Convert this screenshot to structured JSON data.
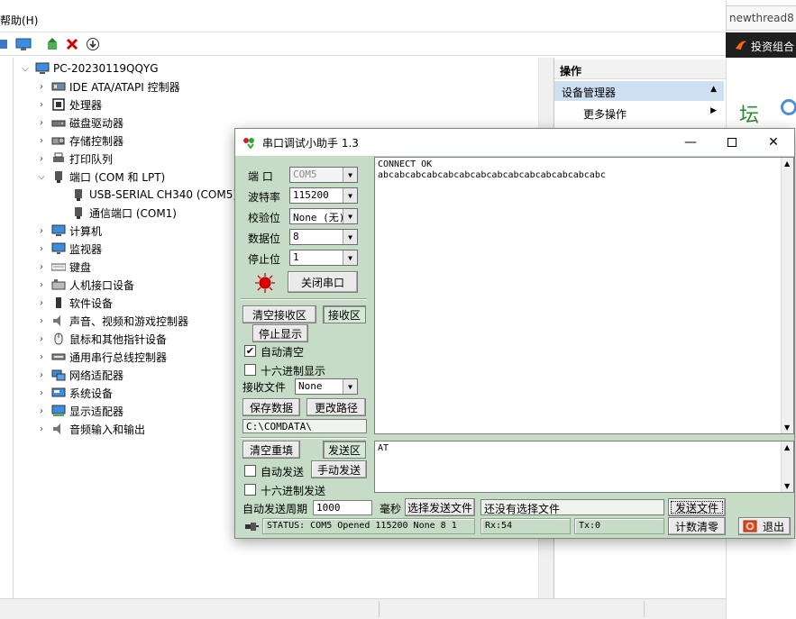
{
  "device_manager": {
    "menu_help": "帮助(H)",
    "tree": {
      "root": "PC-20230119QQYG",
      "items": [
        {
          "label": "IDE ATA/ATAPI 控制器",
          "icon": "ide-controller-icon",
          "expanded": false
        },
        {
          "label": "处理器",
          "icon": "processor-icon",
          "expanded": false
        },
        {
          "label": "磁盘驱动器",
          "icon": "disk-drive-icon",
          "expanded": false
        },
        {
          "label": "存储控制器",
          "icon": "storage-controller-icon",
          "expanded": false
        },
        {
          "label": "打印队列",
          "icon": "printer-icon",
          "expanded": false
        },
        {
          "label": "端口 (COM 和 LPT)",
          "icon": "port-icon",
          "expanded": true
        },
        {
          "label": "USB-SERIAL CH340 (COM5)",
          "icon": "port-device-icon",
          "child": true
        },
        {
          "label": "通信端口 (COM1)",
          "icon": "port-device-icon",
          "child": true
        },
        {
          "label": "计算机",
          "icon": "computer-icon",
          "expanded": false
        },
        {
          "label": "监视器",
          "icon": "monitor-icon",
          "expanded": false
        },
        {
          "label": "键盘",
          "icon": "keyboard-icon",
          "expanded": false
        },
        {
          "label": "人机接口设备",
          "icon": "hid-icon",
          "expanded": false
        },
        {
          "label": "软件设备",
          "icon": "software-device-icon",
          "expanded": false
        },
        {
          "label": "声音、视频和游戏控制器",
          "icon": "sound-icon",
          "expanded": false
        },
        {
          "label": "鼠标和其他指针设备",
          "icon": "mouse-icon",
          "expanded": false
        },
        {
          "label": "通用串行总线控制器",
          "icon": "usb-icon",
          "expanded": false
        },
        {
          "label": "网络适配器",
          "icon": "network-icon",
          "expanded": false
        },
        {
          "label": "系统设备",
          "icon": "system-device-icon",
          "expanded": false
        },
        {
          "label": "显示适配器",
          "icon": "display-adapter-icon",
          "expanded": false
        },
        {
          "label": "音频输入和输出",
          "icon": "audio-io-icon",
          "expanded": false
        }
      ]
    },
    "actions": {
      "header": "操作",
      "selected": "设备管理器",
      "more": "更多操作"
    }
  },
  "background_app": {
    "tab_text": "newthread8",
    "dark_bar_text": "投资组合",
    "glyph": "坛"
  },
  "serial_tool": {
    "title": "串口调试小助手 1.3",
    "labels": {
      "port": "端  口",
      "baud": "波特率",
      "parity": "校验位",
      "databits": "数据位",
      "stopbits": "停止位"
    },
    "values": {
      "port": "COM5",
      "baud": "115200",
      "parity": "None (无)",
      "databits": "8",
      "stopbits": "1"
    },
    "buttons": {
      "close_port": "关闭串口",
      "clear_rx": "清空接收区",
      "rx_area": "接收区",
      "stop_display": "停止显示",
      "save_data": "保存数据",
      "change_path": "更改路径",
      "clear_resend": "清空重填",
      "tx_area": "发送区",
      "manual_send": "手动发送",
      "select_file": "选择发送文件",
      "send_file": "发送文件",
      "count_clear": "计数清零",
      "exit": "退出"
    },
    "checks": {
      "auto_clear": "自动清空",
      "hex_display": "十六进制显示",
      "auto_send": "自动发送",
      "hex_send": "十六进制发送"
    },
    "auto_clear_checked": true,
    "rx_file_label": "接收文件",
    "rx_file_value": "None",
    "path_value": "C:\\COMDATA\\",
    "period_label": "自动发送周期",
    "period_value": "1000",
    "ms_label": "毫秒",
    "file_status": "还没有选择文件",
    "rx_text_line1": "CONNECT OK",
    "rx_text_line2": "abcabcabcabcabcabcabcabcabcabcabcabcabcabc",
    "tx_text": "AT",
    "status": "STATUS: COM5 Opened 115200 None  8 1",
    "rx_count": "Rx:54",
    "tx_count": "Tx:0",
    "colors": {
      "panel": "#c6dcc6",
      "indicator": "#e00000"
    }
  }
}
